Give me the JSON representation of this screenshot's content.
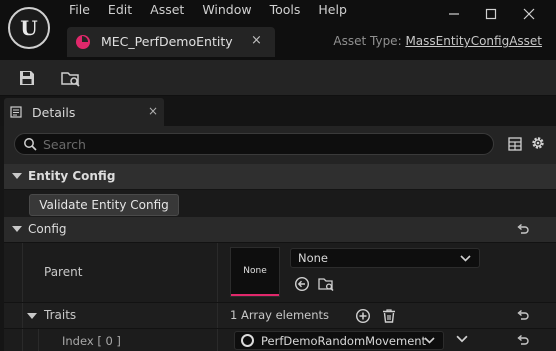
{
  "app": {
    "logo_letter": "U"
  },
  "menu": [
    "File",
    "Edit",
    "Asset",
    "Window",
    "Tools",
    "Help"
  ],
  "window_controls": {
    "minimize": "—",
    "maximize": "☐",
    "close": "✕"
  },
  "tab": {
    "title": "MEC_PerfDemoEntity",
    "close": "×"
  },
  "asset_type": {
    "label": "Asset Type:",
    "value": "MassEntityConfigAsset"
  },
  "colors": {
    "accent": "#e0286b"
  },
  "details_panel": {
    "title": "Details",
    "close": "×",
    "search_placeholder": "Search"
  },
  "sections": {
    "entity_config": {
      "label": "Entity Config",
      "validate_button": "Validate Entity Config"
    },
    "config": {
      "label": "Config",
      "parent": {
        "label": "Parent",
        "thumbnail_text": "None",
        "value": "None"
      },
      "traits": {
        "label": "Traits",
        "count_text": "1 Array elements",
        "items": [
          {
            "index_label": "Index [ 0 ]",
            "value": "PerfDemoRandomMovement"
          }
        ]
      }
    }
  }
}
